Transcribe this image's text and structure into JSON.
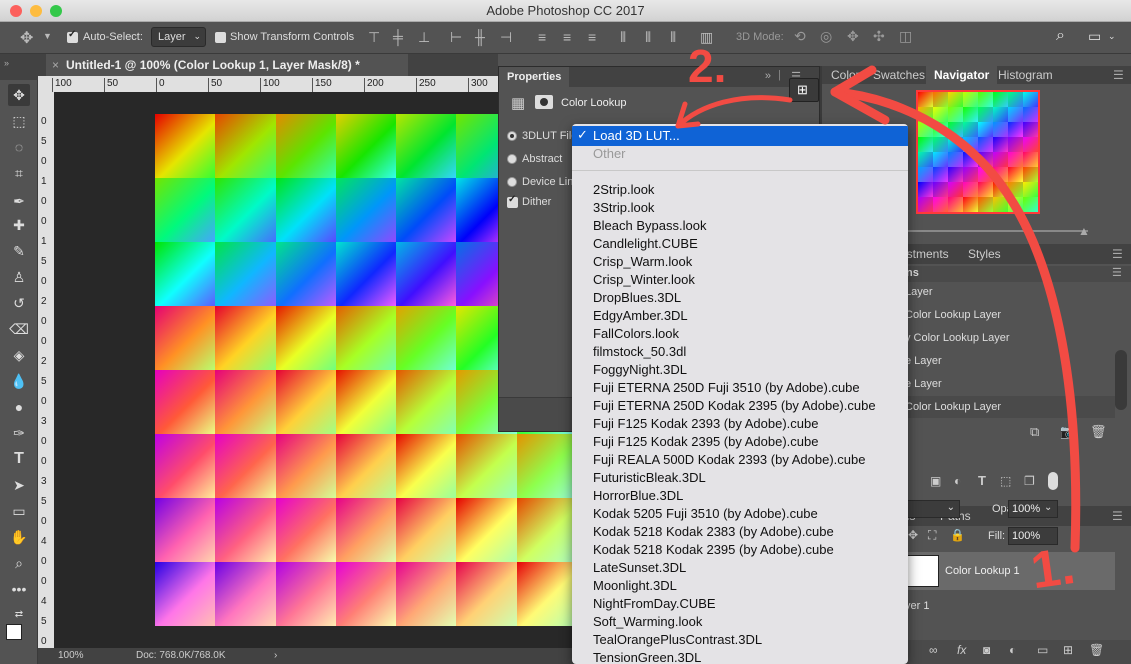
{
  "app": {
    "title": "Adobe Photoshop CC 2017",
    "traffic_colors": [
      "#fc605c",
      "#fdbc40",
      "#34c84a"
    ]
  },
  "options_bar": {
    "auto_select_label": "Auto-Select:",
    "auto_select_value": "Layer",
    "show_transform_label": "Show Transform Controls",
    "mode_3d_label": "3D Mode:"
  },
  "document": {
    "tab_title": "Untitled-1 @ 100% (Color Lookup 1, Layer Mask/8) *",
    "zoom": "100%",
    "doc_size": "Doc: 768.0K/768.0K",
    "ruler_h": [
      "100",
      "50",
      "0",
      "50",
      "100",
      "150",
      "200",
      "250",
      "300"
    ],
    "ruler_v": [
      "0",
      "5",
      "0",
      "1",
      "0",
      "0",
      "1",
      "5",
      "0",
      "2",
      "0",
      "0",
      "2",
      "5",
      "0",
      "3",
      "0",
      "0",
      "3",
      "5",
      "0",
      "4",
      "0",
      "0",
      "4",
      "5",
      "0"
    ]
  },
  "properties": {
    "tab_label": "Properties",
    "panel_title": "Color Lookup",
    "options": [
      {
        "label": "3DLUT File",
        "selected": true
      },
      {
        "label": "Abstract",
        "selected": false
      },
      {
        "label": "Device Link",
        "selected": false
      }
    ],
    "dither_label": "Dither",
    "dither_checked": true
  },
  "lut_menu": {
    "selected": "Load 3D LUT...",
    "disabled": "Other",
    "items": [
      "2Strip.look",
      "3Strip.look",
      "Bleach Bypass.look",
      "Candlelight.CUBE",
      "Crisp_Warm.look",
      "Crisp_Winter.look",
      "DropBlues.3DL",
      "EdgyAmber.3DL",
      "FallColors.look",
      "filmstock_50.3dl",
      "FoggyNight.3DL",
      "Fuji ETERNA 250D Fuji 3510 (by Adobe).cube",
      "Fuji ETERNA 250D Kodak 2395 (by Adobe).cube",
      "Fuji F125 Kodak 2393 (by Adobe).cube",
      "Fuji F125 Kodak 2395 (by Adobe).cube",
      "Fuji REALA 500D Kodak 2393 (by Adobe).cube",
      "FuturisticBleak.3DL",
      "HorrorBlue.3DL",
      "Kodak 5205 Fuji 3510 (by Adobe).cube",
      "Kodak 5218 Kodak 2383 (by Adobe).cube",
      "Kodak 5218 Kodak 2395 (by Adobe).cube",
      "LateSunset.3DL",
      "Moonlight.3DL",
      "NightFromDay.CUBE",
      "Soft_Warming.look",
      "TealOrangePlusContrast.3DL",
      "TensionGreen.3DL"
    ]
  },
  "right_panels": {
    "tabs_top": [
      "Color",
      "Swatches",
      "Navigator",
      "Histogram"
    ],
    "active_top": "Navigator",
    "tabs_mid": [
      "ustments",
      "Styles"
    ],
    "mid_header": "ns",
    "adjust_items": [
      "Layer",
      "Color Lookup Layer",
      "y Color Lookup Layer",
      "e Layer",
      "e Layer",
      "Color Lookup Layer"
    ],
    "tabs_layers": [
      "els",
      "Paths"
    ],
    "opacity_label": "Opacity:",
    "opacity_value": "100%",
    "fill_label": "Fill:",
    "fill_value": "100%",
    "layers": [
      "Color Lookup 1",
      "yer 1"
    ]
  },
  "annotations": {
    "step1": "1.",
    "step2": "2.",
    "color": "#f24b43"
  }
}
